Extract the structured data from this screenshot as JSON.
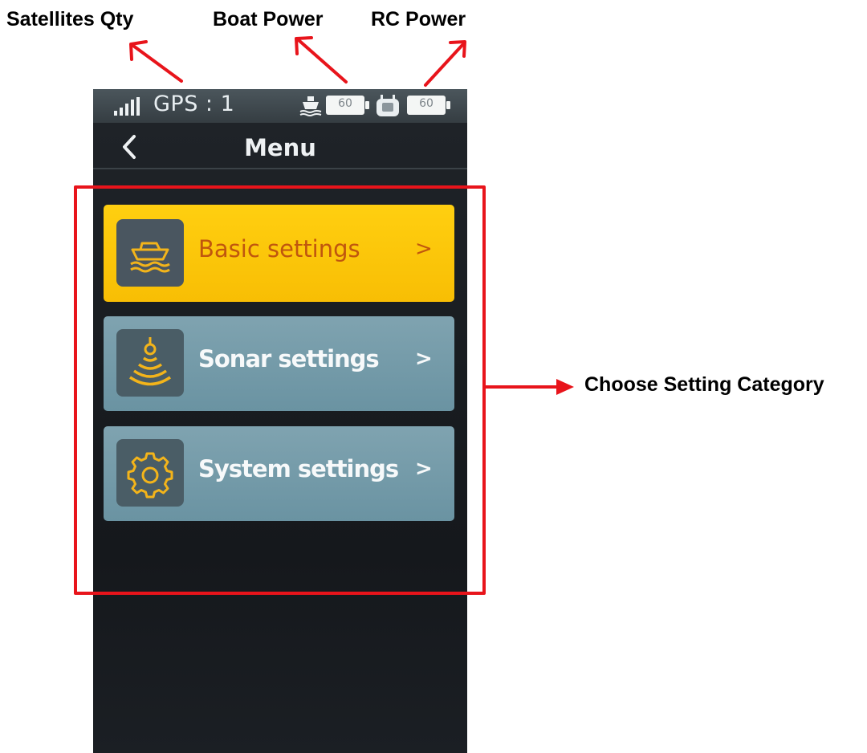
{
  "annotations": {
    "satellites_qty": "Satellites Qty",
    "boat_power": "Boat Power",
    "rc_power": "RC Power",
    "choose_setting_category": "Choose Setting Category",
    "highlight_color": "#e8141b"
  },
  "status_bar": {
    "gps_text": "GPS : 1",
    "boat_battery": "60",
    "rc_battery": "60",
    "signal_icon": "signal-bars-icon",
    "boat_icon": "boat-icon",
    "rc_icon": "remote-control-icon"
  },
  "navbar": {
    "title": "Menu",
    "back_icon": "chevron-left-icon"
  },
  "menu_items": [
    {
      "label": "Basic settings",
      "icon": "boat-icon",
      "chevron": ">",
      "selected": true,
      "color": "#fcc70a"
    },
    {
      "label": "Sonar settings",
      "icon": "sonar-icon",
      "chevron": ">",
      "selected": false,
      "color": "#749ba9"
    },
    {
      "label": "System settings",
      "icon": "gear-icon",
      "chevron": ">",
      "selected": false,
      "color": "#749ba9"
    }
  ]
}
